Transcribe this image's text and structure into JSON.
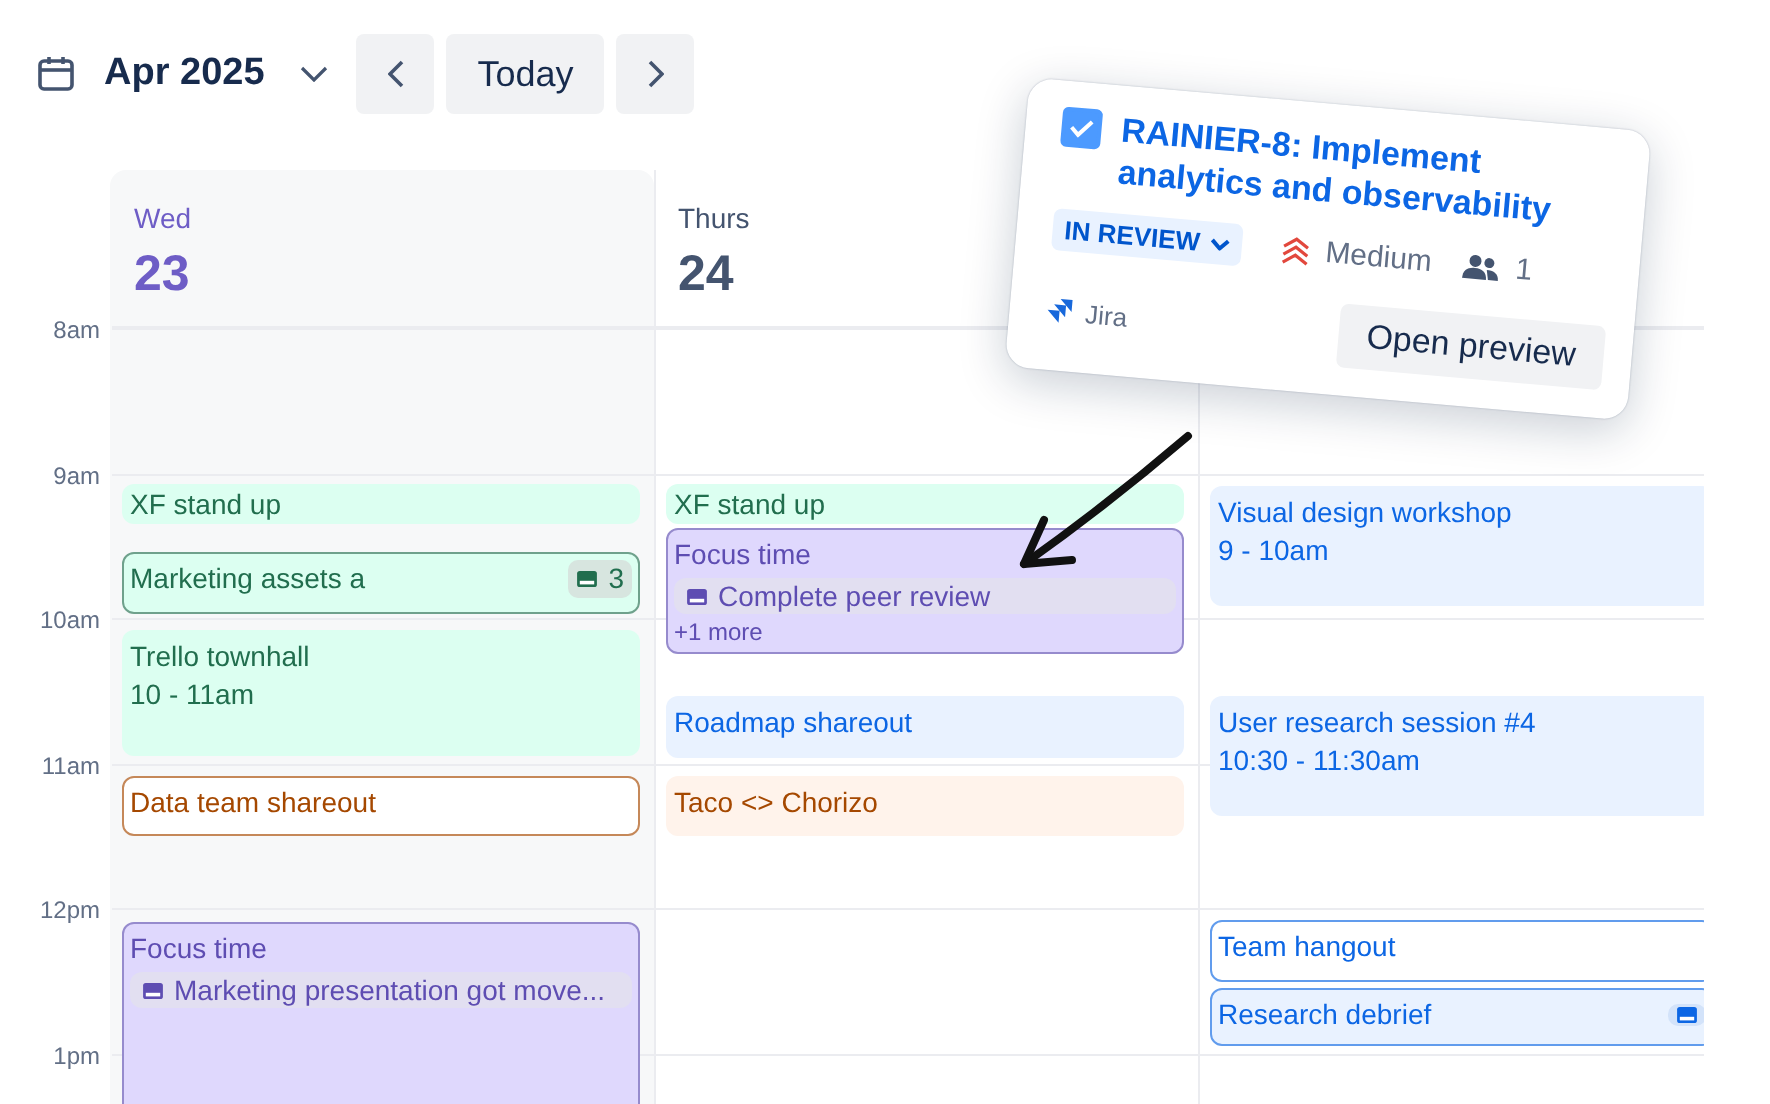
{
  "header": {
    "month": "Apr 2025",
    "today_button": "Today"
  },
  "time_labels": [
    "8am",
    "9am",
    "10am",
    "11am",
    "12pm",
    "1pm"
  ],
  "days": [
    {
      "weekday": "Wed",
      "date": "23",
      "today": true,
      "events": [
        {
          "title": "XF stand up",
          "color": "#216e4e",
          "outlined": false
        },
        {
          "title": "Marketing assets a",
          "color": "#216e4e",
          "outlined": true,
          "has_badge": true,
          "badge_count": "3"
        },
        {
          "title": "Trello townhall",
          "time": "10 - 11am",
          "color": "#216e4e",
          "outlined": false
        },
        {
          "title": "Data team shareout",
          "color": "#a54800",
          "outlined": true,
          "white": true
        },
        {
          "title": "Focus time",
          "color": "#5e4db2",
          "outlined": true,
          "chips": [
            "Marketing presentation got move..."
          ]
        }
      ]
    },
    {
      "weekday": "Thurs",
      "date": "24",
      "today": false,
      "events": [
        {
          "title": "XF stand up",
          "color": "#216e4e",
          "outlined": false
        },
        {
          "title": "Focus time",
          "color": "#5e4db2",
          "outlined": true,
          "chips": [
            "Complete peer review"
          ],
          "more": "+1 more"
        },
        {
          "title": "Roadmap shareout",
          "color": "#0c66e4",
          "outlined": false
        },
        {
          "title": "Taco <> Chorizo",
          "color": "#a54800",
          "outlined": false
        }
      ]
    },
    {
      "events": [
        {
          "title": "Visual design workshop",
          "time": "9 - 10am",
          "color": "#0c66e4",
          "outlined": false
        },
        {
          "title": "User research session #4",
          "time": "10:30 - 11:30am",
          "color": "#0c66e4",
          "outlined": false
        },
        {
          "title": "Team hangout",
          "color": "#0c66e4",
          "outlined": true,
          "white": true
        },
        {
          "title": "Research debrief",
          "color": "#0c66e4",
          "outlined": true,
          "has_badge": true
        }
      ]
    }
  ],
  "popup": {
    "checked": true,
    "title": "RAINIER-8: Implement analytics and observability",
    "status": "IN REVIEW",
    "priority": "Medium",
    "assignees": "1",
    "source": "Jira",
    "button": "Open preview"
  }
}
